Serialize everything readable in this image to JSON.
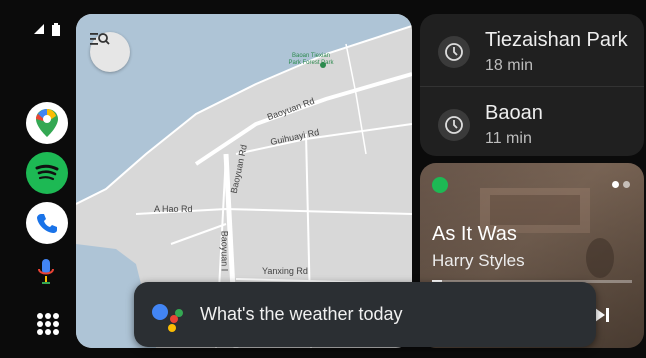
{
  "rail": {
    "apps": [
      {
        "name": "Google Maps",
        "icon": "google-maps-icon"
      },
      {
        "name": "Spotify",
        "icon": "spotify-icon"
      },
      {
        "name": "Phone",
        "icon": "phone-icon"
      }
    ],
    "mic_icon": "microphone-icon",
    "launcher_icon": "app-grid-icon"
  },
  "map": {
    "labels": {
      "baoyuan_rd_top": "Baoyuan Rd",
      "baoyuan_rd_vertical": "Baoyuan Rd",
      "guihuayi_rd": "Guihuayi Rd",
      "a_hao_rd": "A Hao Rd",
      "baoyuan_vertical_bottom": "Baoyuan I",
      "yanxing_rd": "Yanxing Rd",
      "poi": "Baoan Tiexian\nPark Forest Park"
    }
  },
  "destinations": [
    {
      "name": "Tiezaishan Park",
      "time": "18 min"
    },
    {
      "name": "Baoan",
      "time": "11 min"
    }
  ],
  "media": {
    "song": "As It Was",
    "artist": "Harry Styles",
    "progress": 0.05
  },
  "assistant": {
    "query": "What's the weather today"
  },
  "colors": {
    "spotify": "#1DB954",
    "card": "#202020",
    "assistant_bar": "#2b2f33",
    "map_land": "#d8d8d8",
    "map_water": "#aec4d6"
  }
}
